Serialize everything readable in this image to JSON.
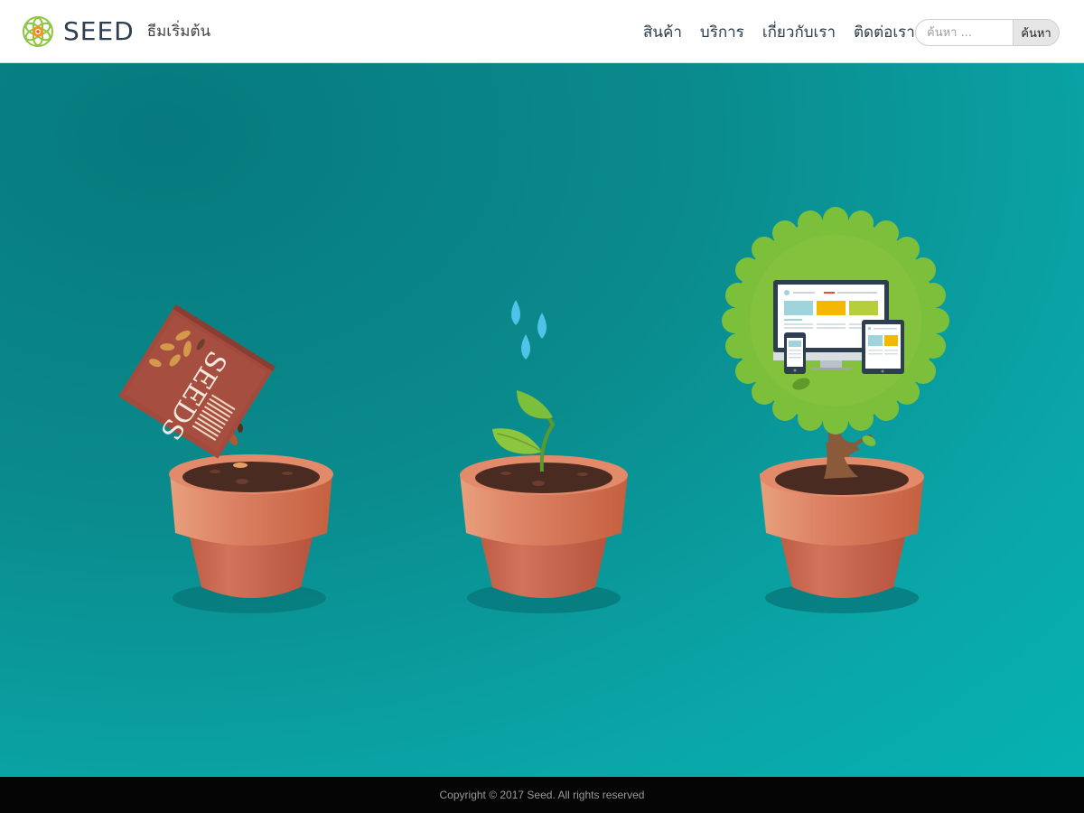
{
  "header": {
    "brand_name": "SEED",
    "brand_tagline": "ธีมเริ่มต้น",
    "logo_icon": "flower-logo-icon",
    "nav": [
      {
        "label": "สินค้า"
      },
      {
        "label": "บริการ"
      },
      {
        "label": "เกี่ยวกับเรา"
      },
      {
        "label": "ติดต่อเรา"
      }
    ],
    "search": {
      "placeholder": "ค้นหา ...",
      "value": "",
      "button_label": "ค้นหา"
    }
  },
  "hero": {
    "illustration": "seed-to-tree-growth-illustration",
    "seed_packet_label": "SEEDS",
    "colors": {
      "background": "#0aa5a7",
      "pot": "#c8644c",
      "leaf": "#7cbf3a"
    }
  },
  "footer": {
    "copyright": "Copyright © 2017 Seed. All rights reserved"
  }
}
